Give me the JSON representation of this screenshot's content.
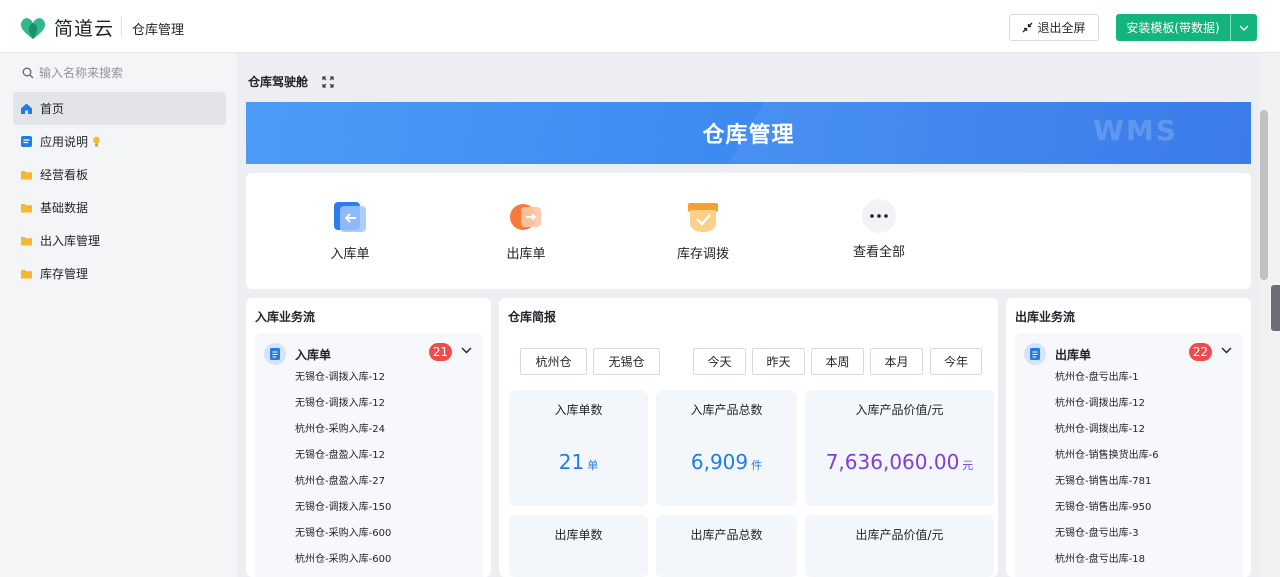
{
  "header": {
    "logo_text": "简道云",
    "app_title": "仓库管理",
    "exit_fullscreen": "退出全屏",
    "install_template": "安装模板(带数据)"
  },
  "sidebar": {
    "search_placeholder": "输入名称来搜索",
    "items": [
      {
        "label": "首页",
        "icon": "home-icon"
      },
      {
        "label": "应用说明",
        "icon": "doc-icon"
      },
      {
        "label": "经营看板",
        "icon": "folder-icon"
      },
      {
        "label": "基础数据",
        "icon": "folder-icon"
      },
      {
        "label": "出入库管理",
        "icon": "folder-icon"
      },
      {
        "label": "库存管理",
        "icon": "folder-icon"
      }
    ]
  },
  "main": {
    "title": "仓库驾驶舱",
    "banner_title": "仓库管理",
    "banner_mark": "WMS",
    "quick_actions": [
      {
        "label": "入库单",
        "icon": "inbound-icon"
      },
      {
        "label": "出库单",
        "icon": "outbound-icon"
      },
      {
        "label": "库存调拨",
        "icon": "transfer-icon"
      },
      {
        "label": "查看全部",
        "icon": "more-icon"
      }
    ]
  },
  "inbound": {
    "title": "入库业务流",
    "head": "入库单",
    "count": "21",
    "items": [
      "无锡仓-调拨入库-12",
      "无锡仓-调拨入库-12",
      "杭州仓-采购入库-24",
      "无锡仓-盘盈入库-12",
      "杭州仓-盘盈入库-27",
      "无锡仓-调拨入库-150",
      "无锡仓-采购入库-600",
      "杭州仓-采购入库-600"
    ]
  },
  "outbound": {
    "title": "出库业务流",
    "head": "出库单",
    "count": "22",
    "items": [
      "杭州仓-盘亏出库-1",
      "杭州仓-调拨出库-12",
      "杭州仓-调拨出库-12",
      "杭州仓-销售换货出库-6",
      "无锡仓-销售出库-781",
      "无锡仓-销售出库-950",
      "无锡仓-盘亏出库-3",
      "杭州仓-盘亏出库-18"
    ]
  },
  "report": {
    "title": "仓库简报",
    "warehouses": [
      "杭州仓",
      "无锡仓"
    ],
    "periods": [
      "今天",
      "昨天",
      "本周",
      "本月",
      "今年"
    ],
    "stats": [
      {
        "label": "入库单数",
        "value": "21",
        "unit": "单"
      },
      {
        "label": "入库产品总数",
        "value": "6,909",
        "unit": "件"
      },
      {
        "label": "入库产品价值/元",
        "value": "7,636,060.00",
        "unit": "元"
      },
      {
        "label": "出库单数"
      },
      {
        "label": "出库产品总数"
      },
      {
        "label": "出库产品价值/元"
      }
    ]
  },
  "colors": {
    "accent": "#14b47d",
    "banner": "#3f8df2",
    "badge": "#f04b4b",
    "value_blue": "#1f7ce8",
    "value_purple": "#7e3fd8"
  }
}
